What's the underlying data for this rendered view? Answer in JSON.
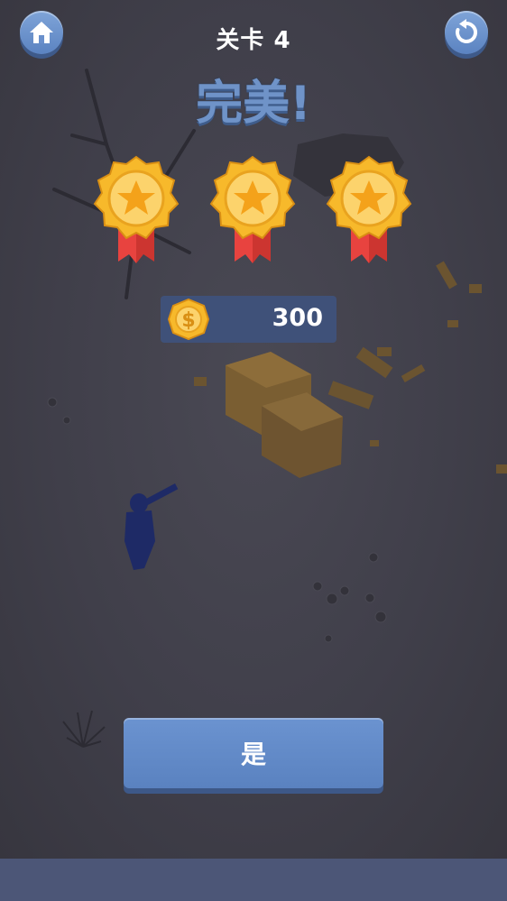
{
  "header": {
    "level_label": "关卡 4",
    "home_icon": "home-icon",
    "restart_icon": "restart-icon"
  },
  "result": {
    "title": "完美!",
    "stars_earned": 3,
    "stars_total": 3
  },
  "reward": {
    "coins": "300",
    "coin_icon": "dollar-coin-icon"
  },
  "actions": {
    "confirm_label": "是"
  },
  "colors": {
    "accent_blue": "#6b93d0",
    "title_blue": "#6f93c8",
    "medal_gold": "#f7b92b",
    "ribbon_red": "#e8433f",
    "panel_blue": "#3f5179",
    "background": "#403f4a"
  }
}
